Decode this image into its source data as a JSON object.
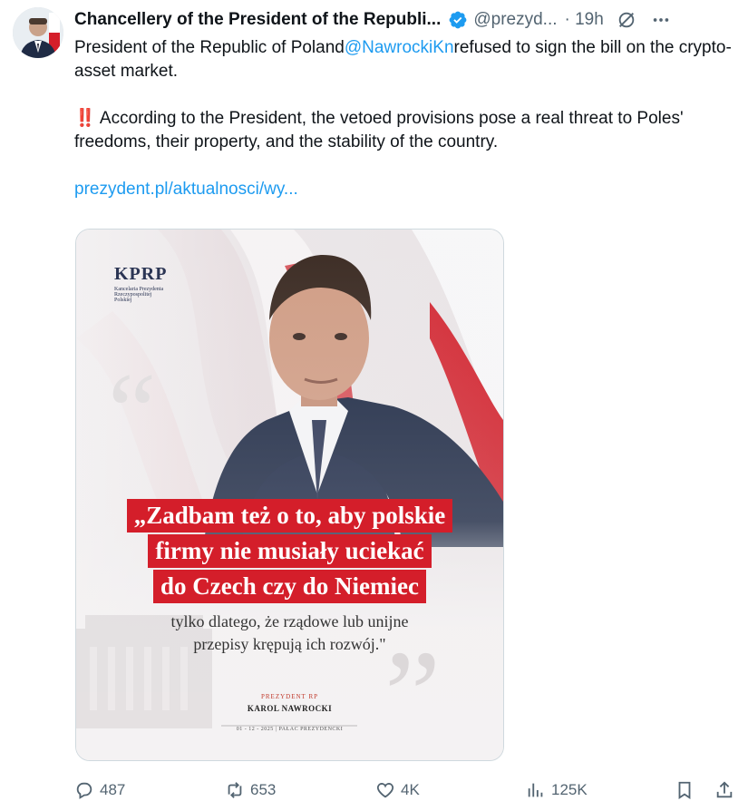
{
  "tweet": {
    "author_name": "Chancellery of the President of the Republi...",
    "handle": "@prezyd...",
    "time": "· 19h",
    "paragraph1_prefix": "President of the Republic of Poland",
    "paragraph1_mention": "@NawrockiKn",
    "paragraph1_suffix": "refused to sign the bill on the crypto-asset market.",
    "paragraph2_icon": "‼️",
    "paragraph2": "According to the President, the vetoed provisions pose a real threat to Poles' freedoms, their property, and the stability of the country.",
    "link": "prezydent.pl/aktualnosci/wy..."
  },
  "media": {
    "logo": "KPRP",
    "logo_sub1": "Kancelaria Prezydenta",
    "logo_sub2": "Rzeczypospolitej",
    "logo_sub3": "Polskiej",
    "quote_line1": "„Zadbam też o to, aby polskie",
    "quote_line2": "firmy nie musiały uciekać",
    "quote_line3": "do Czech czy do Niemiec",
    "sub_line1": "tylko dlatego, że rządowe lub unijne",
    "sub_line2": "przepisy krępują ich rozwój.\"",
    "role": "PREZYDENT RP",
    "signature_name": "KAROL NAWROCKI",
    "footer": "01 - 12 - 2025  |  PAŁAC PREZYDENCKI"
  },
  "actions": {
    "replies": "487",
    "reposts": "653",
    "likes": "4K",
    "views": "125K"
  },
  "colors": {
    "accent": "#1d9bf0",
    "red": "#d41e2a",
    "muted": "#536471"
  },
  "icons": [
    "verified-badge-icon",
    "grok-icon",
    "more-icon",
    "reply-icon",
    "repost-icon",
    "like-icon",
    "views-icon",
    "bookmark-icon",
    "share-icon"
  ]
}
